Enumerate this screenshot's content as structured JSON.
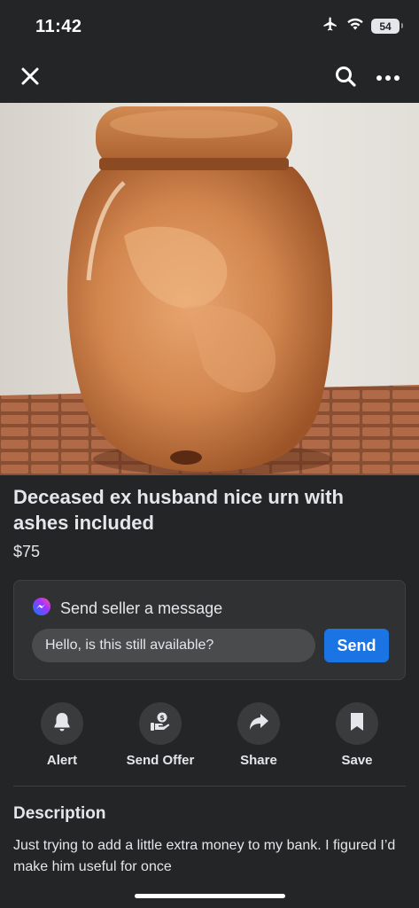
{
  "status_bar": {
    "time": "11:42",
    "battery": "54",
    "icons": [
      "airplane-icon",
      "wifi-icon",
      "battery-icon"
    ]
  },
  "nav": {
    "icons": [
      "close-icon",
      "search-icon",
      "more-icon"
    ]
  },
  "listing": {
    "title": "Deceased ex husband nice urn with ashes included",
    "price": "$75"
  },
  "message": {
    "header": "Send seller a message",
    "input_value": "Hello, is this still available?",
    "send_label": "Send"
  },
  "actions": [
    {
      "label": "Alert",
      "icon": "bell-icon"
    },
    {
      "label": "Send Offer",
      "icon": "offer-icon"
    },
    {
      "label": "Share",
      "icon": "share-icon"
    },
    {
      "label": "Save",
      "icon": "bookmark-icon"
    }
  ],
  "description": {
    "heading": "Description",
    "body": "Just trying to add a little extra money to my bank.  I figured I’d make him useful for once"
  },
  "colors": {
    "background": "#242526",
    "card": "#303133",
    "accent": "#1b74e4",
    "text": "#e4e6eb"
  }
}
